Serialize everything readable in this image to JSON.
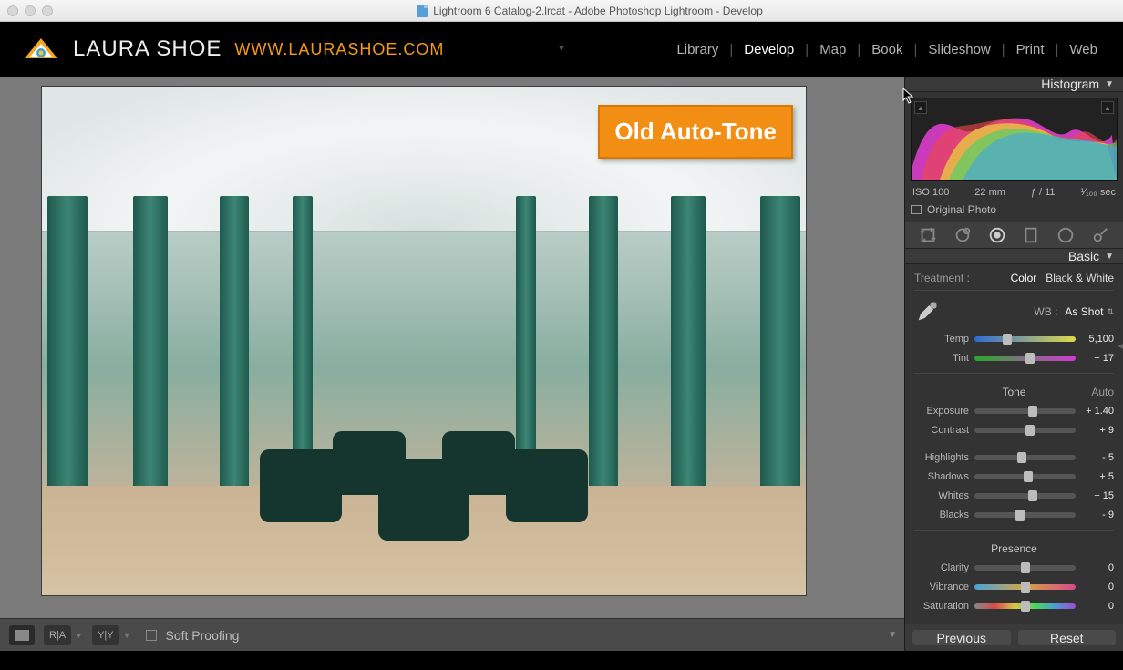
{
  "titlebar": {
    "text": "Lightroom 6 Catalog-2.lrcat - Adobe Photoshop Lightroom - Develop"
  },
  "brand": {
    "name": "LAURA SHOE",
    "url": "WWW.LAURASHOE.COM"
  },
  "modules": {
    "library": "Library",
    "develop": "Develop",
    "map": "Map",
    "book": "Book",
    "slideshow": "Slideshow",
    "print": "Print",
    "web": "Web"
  },
  "overlay": {
    "label": "Old Auto-Tone"
  },
  "toolbar_bottom": {
    "soft_proofing": "Soft Proofing",
    "ra": "R|A",
    "yy": "Y|Y"
  },
  "panels": {
    "histogram": {
      "title": "Histogram",
      "iso": "ISO 100",
      "focal": "22 mm",
      "aperture": "ƒ / 11",
      "shutter": "¹⁄₁₀₀ sec",
      "original": "Original Photo"
    },
    "basic": {
      "title": "Basic",
      "treatment_label": "Treatment :",
      "color": "Color",
      "bw": "Black & White",
      "wb_label": "WB :",
      "wb_value": "As Shot",
      "tone_title": "Tone",
      "auto": "Auto",
      "presence_title": "Presence",
      "sliders": {
        "temp": {
          "label": "Temp",
          "value": "5,100",
          "pos": 32
        },
        "tint": {
          "label": "Tint",
          "value": "+ 17",
          "pos": 55
        },
        "exposure": {
          "label": "Exposure",
          "value": "+ 1.40",
          "pos": 58
        },
        "contrast": {
          "label": "Contrast",
          "value": "+ 9",
          "pos": 55
        },
        "highlights": {
          "label": "Highlights",
          "value": "- 5",
          "pos": 47
        },
        "shadows": {
          "label": "Shadows",
          "value": "+ 5",
          "pos": 53
        },
        "whites": {
          "label": "Whites",
          "value": "+ 15",
          "pos": 58
        },
        "blacks": {
          "label": "Blacks",
          "value": "- 9",
          "pos": 45
        },
        "clarity": {
          "label": "Clarity",
          "value": "0",
          "pos": 50
        },
        "vibrance": {
          "label": "Vibrance",
          "value": "0",
          "pos": 50
        },
        "saturation": {
          "label": "Saturation",
          "value": "0",
          "pos": 50
        }
      }
    },
    "buttons": {
      "previous": "Previous",
      "reset": "Reset"
    }
  }
}
